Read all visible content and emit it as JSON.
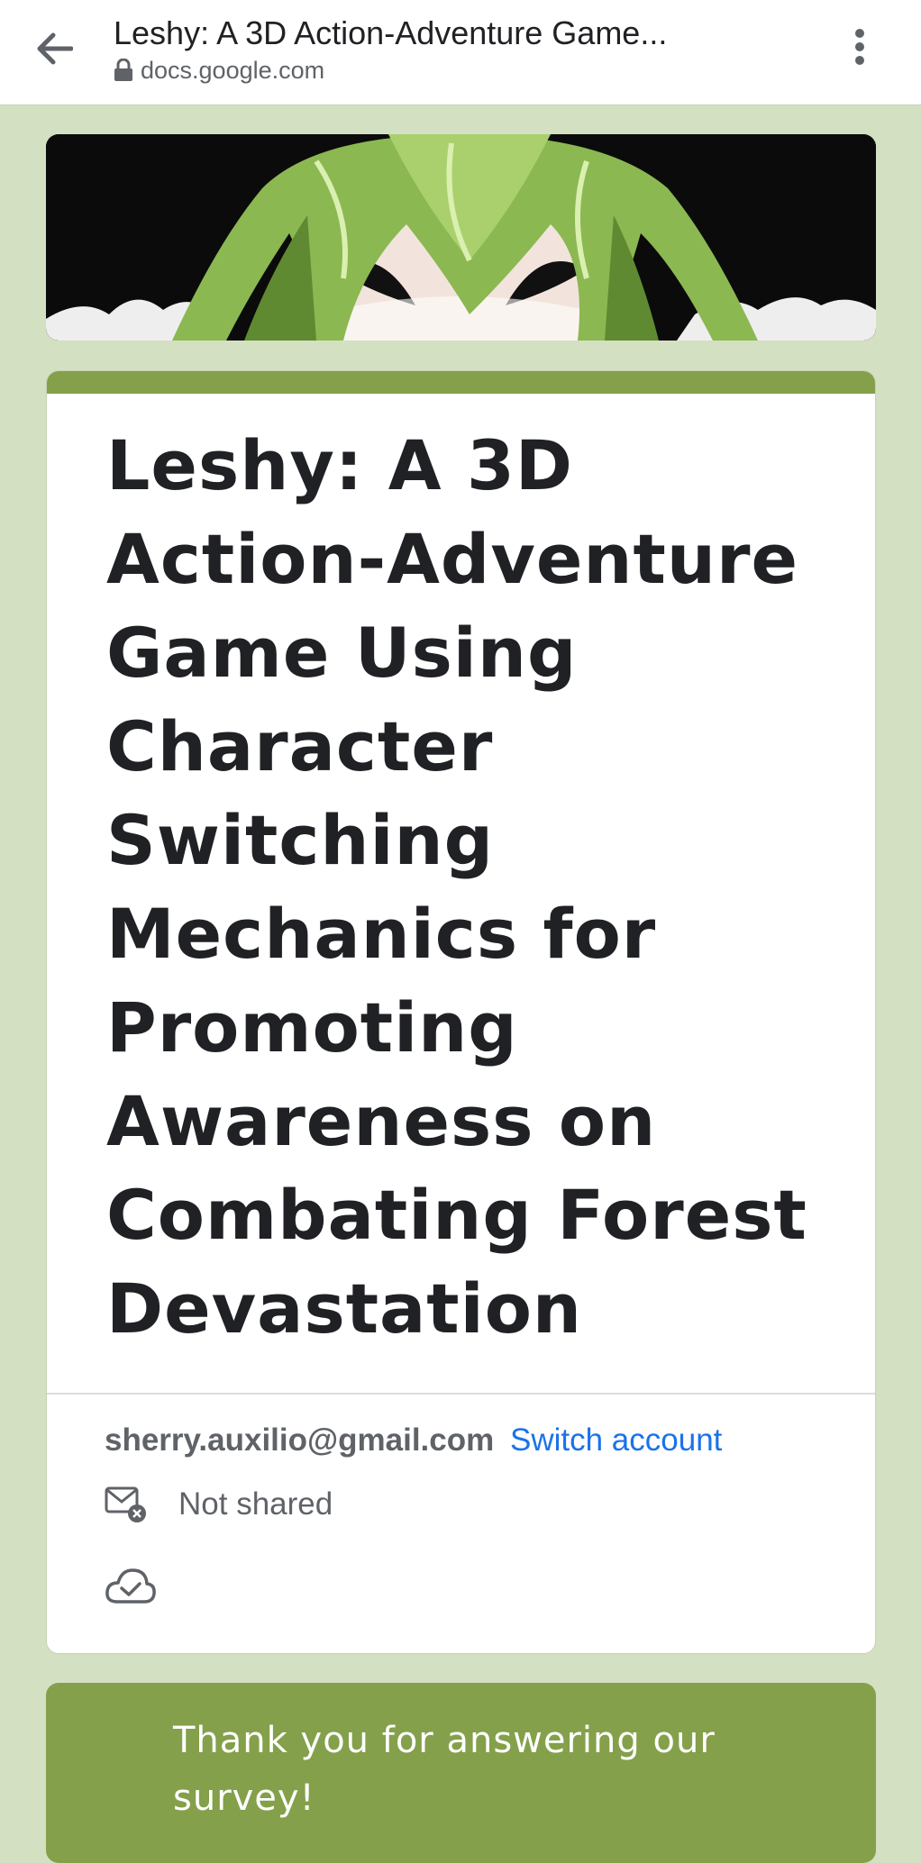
{
  "browser": {
    "page_title": "Leshy: A 3D Action-Adventure Game...",
    "url": "docs.google.com",
    "icons": {
      "back": "arrow-left-icon",
      "lock": "lock-icon",
      "menu": "more-vert-icon"
    }
  },
  "form": {
    "banner_alt": "",
    "accent_color": "#84a04a",
    "title": "Leshy: A 3D Action-Adventure Game Using Character Switching Mechanics for Promoting Awareness on Combating Forest Devastation",
    "account_email": "sherry.auxilio@gmail.com",
    "switch_account_label": "Switch account",
    "share_status": "Not shared",
    "icons": {
      "share": "mail-not-shared-icon",
      "cloud": "cloud-saved-icon"
    }
  },
  "confirmation": {
    "message": "Thank you for answering our survey!"
  }
}
